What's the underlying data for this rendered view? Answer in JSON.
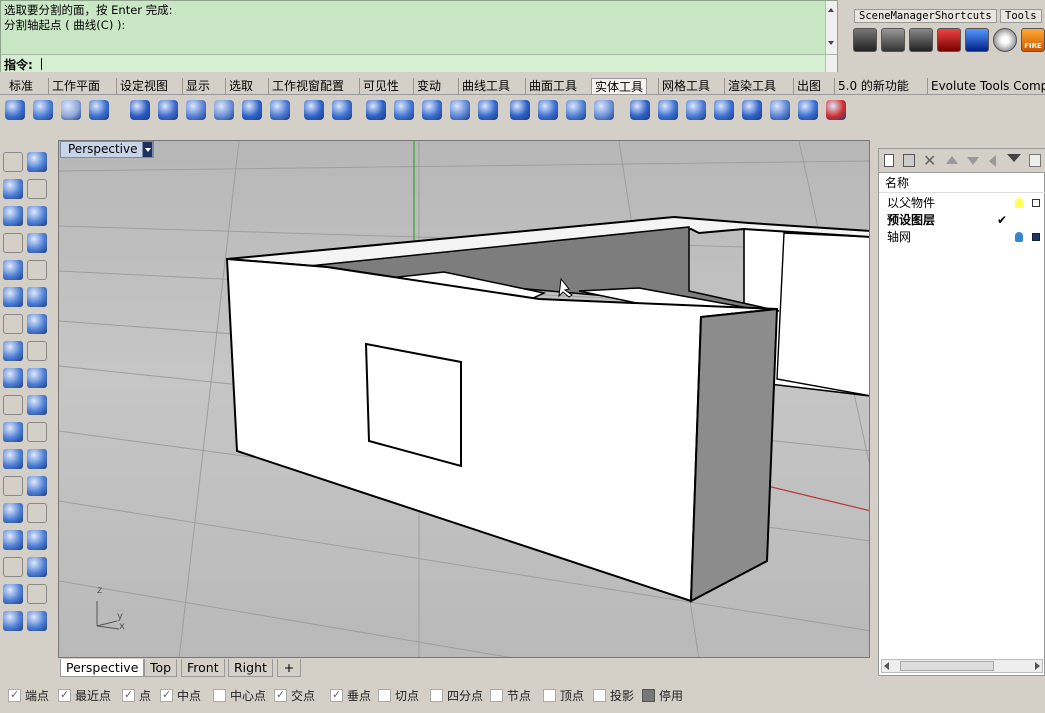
{
  "command": {
    "line1": "选取要分割的面，按 Enter 完成:",
    "line2": "分割轴起点 ( 曲线(C) ):",
    "prompt_label": "指令:"
  },
  "right_toolbar": {
    "tabs": [
      "SceneManagerShortcuts",
      "Tools"
    ]
  },
  "tabs": [
    "标准",
    "工作平面",
    "设定视图",
    "显示",
    "选取",
    "工作视窗配置",
    "可见性",
    "变动",
    "曲线工具",
    "曲面工具",
    "实体工具",
    "网格工具",
    "渲染工具",
    "出图",
    "5.0 的新功能",
    "Evolute Tools Compl"
  ],
  "active_tab": "实体工具",
  "viewport": {
    "title": "Perspective",
    "tabs": [
      "Perspective",
      "Top",
      "Front",
      "Right"
    ],
    "add_tab": "+",
    "axis_labels": {
      "z": "z",
      "y": "y",
      "x": "x"
    }
  },
  "layers": {
    "column_header": "名称",
    "rows": [
      {
        "name": "以父物件",
        "bold": false
      },
      {
        "name": "预设图层",
        "bold": true,
        "current": "✔"
      },
      {
        "name": "轴网",
        "bold": false
      }
    ]
  },
  "osnaps": [
    {
      "label": "端点",
      "checked": true
    },
    {
      "label": "最近点",
      "checked": true
    },
    {
      "label": "点",
      "checked": true
    },
    {
      "label": "中点",
      "checked": true
    },
    {
      "label": "中心点",
      "checked": false
    },
    {
      "label": "交点",
      "checked": true
    },
    {
      "label": "垂点",
      "checked": true
    },
    {
      "label": "切点",
      "checked": false
    },
    {
      "label": "四分点",
      "checked": false
    },
    {
      "label": "节点",
      "checked": false
    },
    {
      "label": "顶点",
      "checked": false
    },
    {
      "label": "投影",
      "checked": false
    },
    {
      "label": "停用",
      "checked": false
    }
  ],
  "fire_label": "FIRE"
}
